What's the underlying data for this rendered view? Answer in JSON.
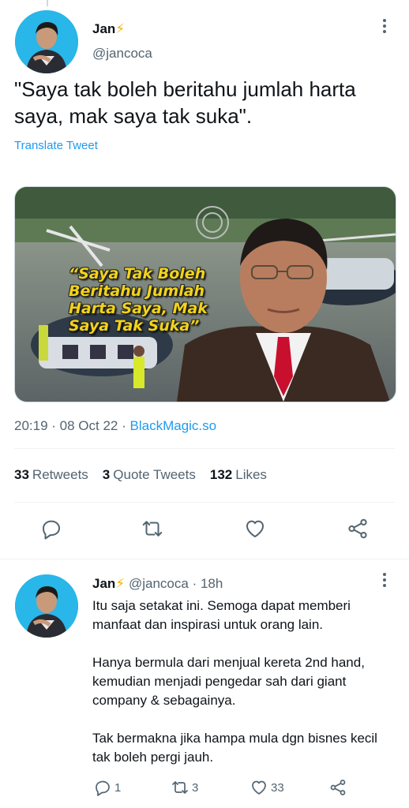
{
  "tweet": {
    "author_name": "Jan",
    "author_handle": "@jancoca",
    "text": "\"Saya tak boleh beritahu jumlah harta saya, mak saya tak suka\".",
    "translate_label": "Translate Tweet",
    "media_overlay_text": "“Saya Tak Boleh Beritahu Jumlah Harta Saya, Mak Saya Tak Suka”",
    "time": "20:19",
    "date": "08 Oct 22",
    "source": "BlackMagic.so",
    "retweets_count": "33",
    "retweets_label": "Retweets",
    "quote_count": "3",
    "quote_label": "Quote Tweets",
    "likes_count": "132",
    "likes_label": "Likes"
  },
  "reply": {
    "author_name": "Jan",
    "author_handle": "@jancoca",
    "age": "18h",
    "paragraphs": [
      "Itu saja setakat ini. Semoga dapat memberi manfaat dan inspirasi untuk orang lain.",
      "Hanya bermula dari menjual kereta 2nd hand, kemudian menjadi pengedar sah dari giant company & sebagainya.",
      "Tak bermakna jika hampa mula dgn bisnes kecil tak boleh pergi jauh."
    ],
    "reply_count": "1",
    "retweet_count": "3",
    "like_count": "33"
  },
  "icons": {
    "reply": "reply-icon",
    "retweet": "retweet-icon",
    "like": "heart-icon",
    "share": "share-icon",
    "more": "more-icon",
    "verified_emoji": "lightning-icon"
  },
  "colors": {
    "accent": "#1d9bf0",
    "secondary_text": "#536471",
    "avatar_bg": "#29b6e8",
    "overlay_text": "#f2d31a"
  }
}
